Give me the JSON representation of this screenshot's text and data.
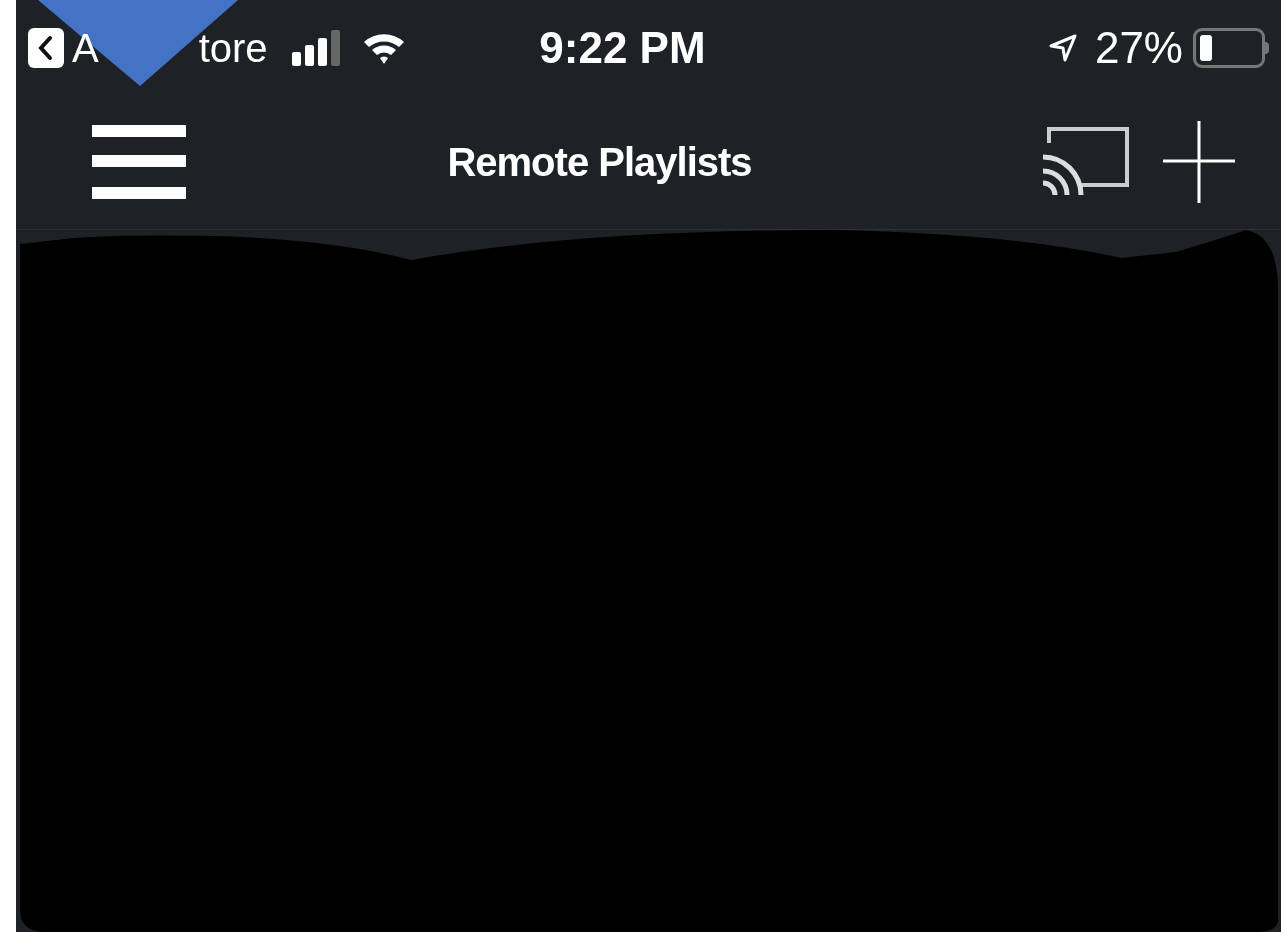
{
  "status_bar": {
    "back_label_parts": [
      "A",
      "tore"
    ],
    "time": "9:22 PM",
    "battery_percent": "27%"
  },
  "nav_bar": {
    "title": "Remote Playlists"
  },
  "annotation": {
    "kind": "arrow"
  }
}
